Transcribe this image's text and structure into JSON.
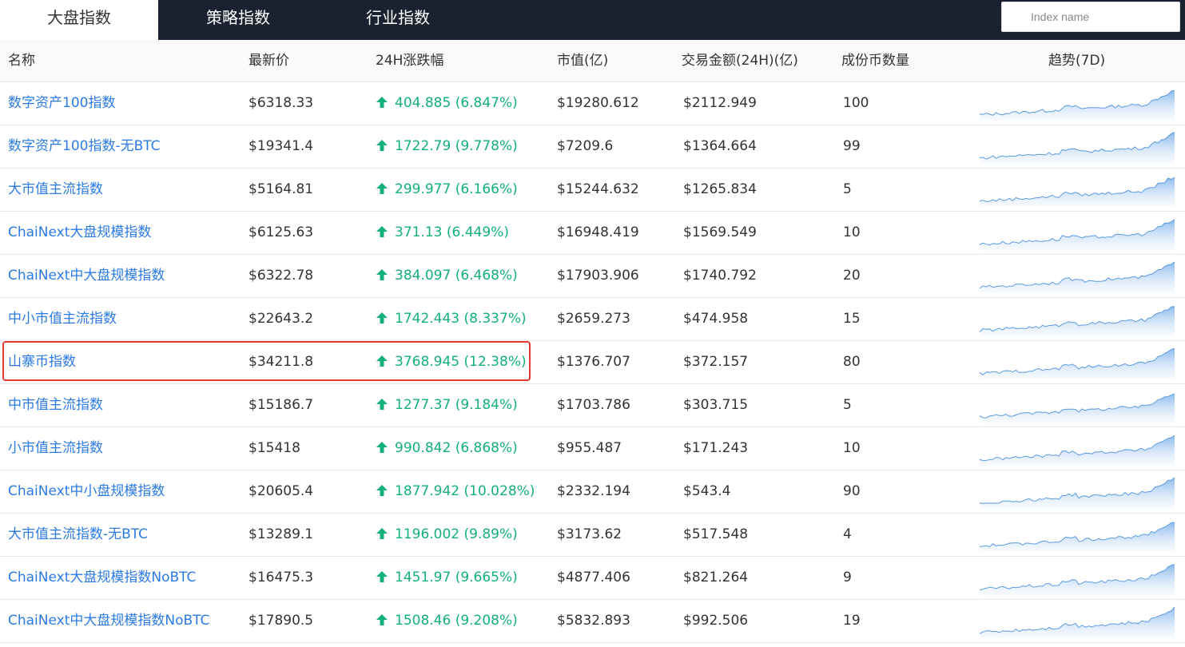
{
  "tabs": [
    {
      "label": "大盘指数",
      "active": true
    },
    {
      "label": "策略指数",
      "active": false
    },
    {
      "label": "行业指数",
      "active": false
    }
  ],
  "search": {
    "placeholder": "Index name"
  },
  "columns": {
    "name": "名称",
    "price": "最新价",
    "change": "24H涨跌幅",
    "cap": "市值(亿)",
    "volume": "交易金额(24H)(亿)",
    "count": "成份币数量",
    "trend": "趋势(7D)"
  },
  "colors": {
    "link": "#2c7be5",
    "up": "#13b07a",
    "header_bg": "#1a2130",
    "highlight": "#e53935"
  },
  "rows": [
    {
      "name": "数字资产100指数",
      "price": "$6318.33",
      "change": "404.885 (6.847%)",
      "cap": "$19280.612",
      "volume": "$2112.949",
      "count": "100",
      "direction": "up"
    },
    {
      "name": "数字资产100指数-无BTC",
      "price": "$19341.4",
      "change": "1722.79 (9.778%)",
      "cap": "$7209.6",
      "volume": "$1364.664",
      "count": "99",
      "direction": "up"
    },
    {
      "name": "大市值主流指数",
      "price": "$5164.81",
      "change": "299.977 (6.166%)",
      "cap": "$15244.632",
      "volume": "$1265.834",
      "count": "5",
      "direction": "up"
    },
    {
      "name": "ChaiNext大盘规模指数",
      "price": "$6125.63",
      "change": "371.13 (6.449%)",
      "cap": "$16948.419",
      "volume": "$1569.549",
      "count": "10",
      "direction": "up"
    },
    {
      "name": "ChaiNext中大盘规模指数",
      "price": "$6322.78",
      "change": "384.097 (6.468%)",
      "cap": "$17903.906",
      "volume": "$1740.792",
      "count": "20",
      "direction": "up"
    },
    {
      "name": "中小市值主流指数",
      "price": "$22643.2",
      "change": "1742.443 (8.337%)",
      "cap": "$2659.273",
      "volume": "$474.958",
      "count": "15",
      "direction": "up"
    },
    {
      "name": "山寨币指数",
      "price": "$34211.8",
      "change": "3768.945 (12.38%)",
      "cap": "$1376.707",
      "volume": "$372.157",
      "count": "80",
      "direction": "up",
      "highlighted": true
    },
    {
      "name": "中市值主流指数",
      "price": "$15186.7",
      "change": "1277.37 (9.184%)",
      "cap": "$1703.786",
      "volume": "$303.715",
      "count": "5",
      "direction": "up"
    },
    {
      "name": "小市值主流指数",
      "price": "$15418",
      "change": "990.842 (6.868%)",
      "cap": "$955.487",
      "volume": "$171.243",
      "count": "10",
      "direction": "up"
    },
    {
      "name": "ChaiNext中小盘规模指数",
      "price": "$20605.4",
      "change": "1877.942 (10.028%)",
      "cap": "$2332.194",
      "volume": "$543.4",
      "count": "90",
      "direction": "up"
    },
    {
      "name": "大市值主流指数-无BTC",
      "price": "$13289.1",
      "change": "1196.002 (9.89%)",
      "cap": "$3173.62",
      "volume": "$517.548",
      "count": "4",
      "direction": "up"
    },
    {
      "name": "ChaiNext大盘规模指数NoBTC",
      "price": "$16475.3",
      "change": "1451.97 (9.665%)",
      "cap": "$4877.406",
      "volume": "$821.264",
      "count": "9",
      "direction": "up"
    },
    {
      "name": "ChaiNext中大盘规模指数NoBTC",
      "price": "$17890.5",
      "change": "1508.46 (9.208%)",
      "cap": "$5832.893",
      "volume": "$992.506",
      "count": "19",
      "direction": "up"
    }
  ]
}
